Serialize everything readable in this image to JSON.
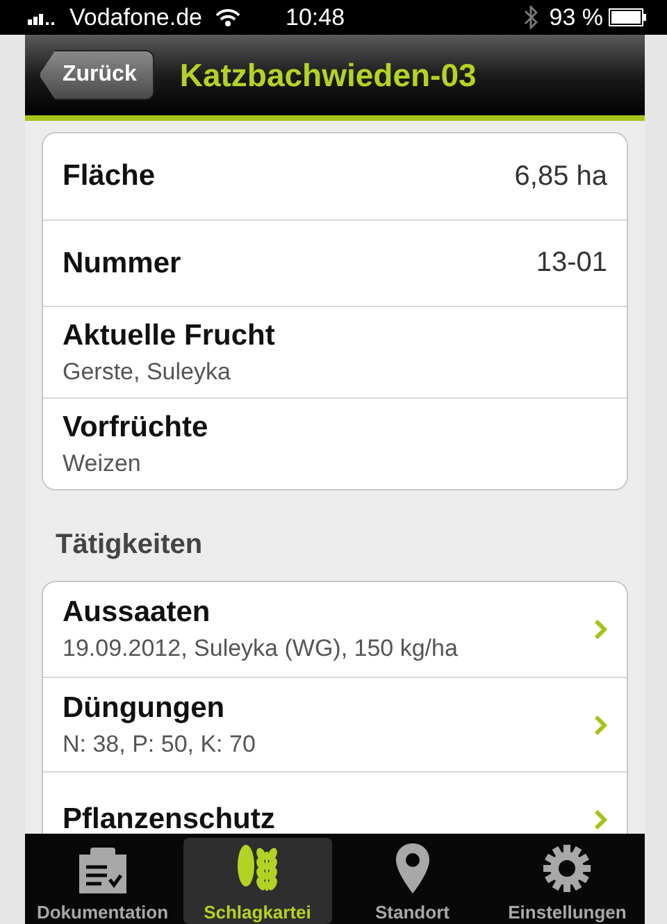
{
  "status_bar": {
    "carrier": "Vodafone.de",
    "time": "10:48",
    "battery": "93 %"
  },
  "nav": {
    "back": "Zurück",
    "title": "Katzbachwieden-03"
  },
  "details": [
    {
      "kind": "value",
      "label": "Fläche",
      "value": "6,85 ha"
    },
    {
      "kind": "value",
      "label": "Nummer",
      "value": "13-01"
    },
    {
      "kind": "detail",
      "label": "Aktuelle Frucht",
      "sub": "Gerste, Suleyka"
    },
    {
      "kind": "detail",
      "label": "Vorfrüchte",
      "sub": "Weizen"
    }
  ],
  "section": "Tätigkeiten",
  "activities": [
    {
      "label": "Aussaaten",
      "sub": "19.09.2012, Suleyka (WG), 150 kg/ha"
    },
    {
      "label": "Düngungen",
      "sub": "N: 38, P: 50, K: 70"
    },
    {
      "label": "Pflanzenschutz"
    }
  ],
  "tabs": [
    {
      "label": "Dokumentation",
      "selected": false
    },
    {
      "label": "Schlagkartei",
      "selected": true
    },
    {
      "label": "Standort",
      "selected": false
    },
    {
      "label": "Einstellungen",
      "selected": false
    }
  ]
}
